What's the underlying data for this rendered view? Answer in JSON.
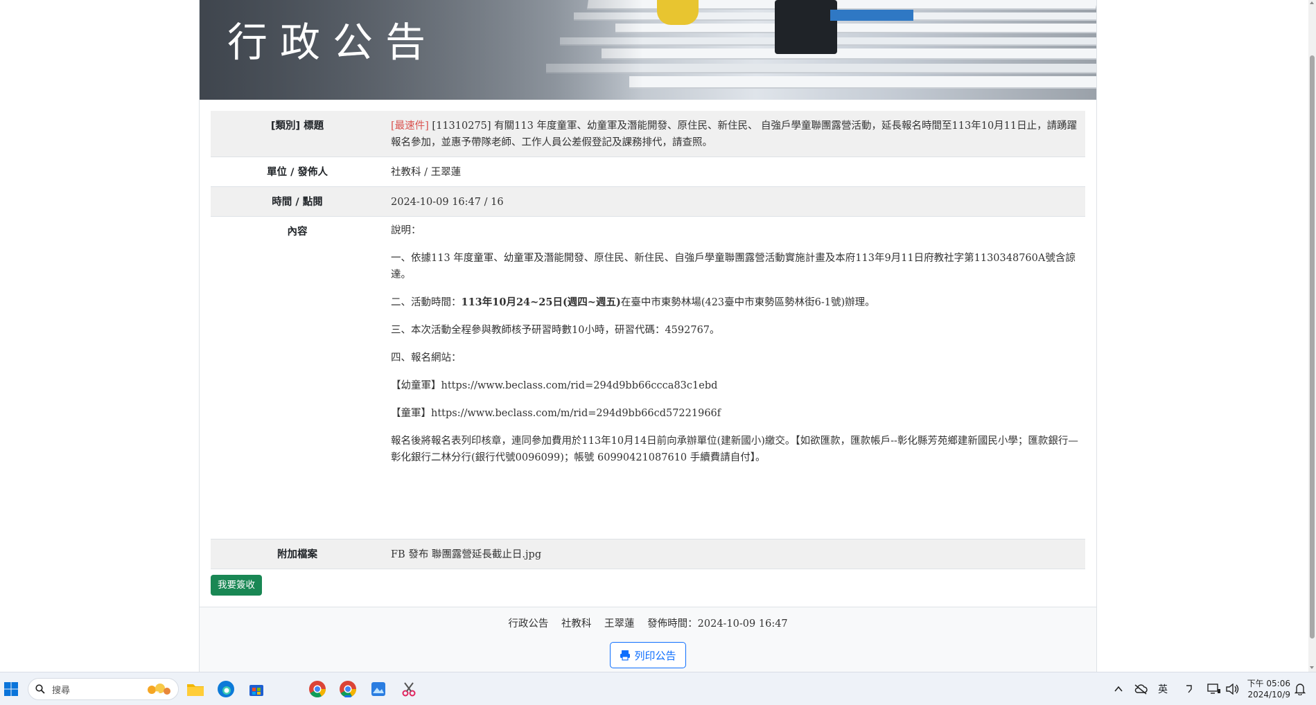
{
  "banner": {
    "title": "行政公告"
  },
  "detail": {
    "title_label": "[類別] 標題",
    "category": "[最速件]",
    "title_text": " [11310275] 有關113 年度童軍、幼童軍及潛能開發、原住民、新住民、 自強戶學童聯團露營活動，延長報名時間至113年10月11日止，請踴躍報名參加，並惠予帶隊老師、工作人員公差假登記及課務排代，請查照。",
    "unit_label": "單位 / 發佈人",
    "unit_value": "社教科 / 王翠蓮",
    "time_label": "時間 / 點閱",
    "time_value": "2024-10-09 16:47 / 16",
    "content_label": "內容",
    "content": {
      "intro": "說明：",
      "p1": "一、依據113 年度童軍、幼童軍及潛能開發、原住民、新住民、自強戶學童聯團露營活動實施計畫及本府113年9月11日府教社字第1130348760A號含諒達。",
      "p2_prefix": "二、活動時間：",
      "p2_bold": "113年10月24~25日(週四~週五)",
      "p2_suffix": "在臺中市東勢林場(423臺中市東勢區勢林街6-1號)辦理。",
      "p3": "三、本次活動全程參與教師核予研習時數10小時，研習代碼：4592767。",
      "p4": "四、報名網站：",
      "p5": "【幼童軍】https://www.beclass.com/rid=294d9bb66ccca83c1ebd",
      "p6": "【童軍】https://www.beclass.com/m/rid=294d9bb66cd57221966f",
      "p7": "報名後將報名表列印核章，連同參加費用於113年10月14日前向承辦單位(建新國小)繳交。【如欲匯款，匯款帳戶--彰化縣芳苑鄉建新國民小學；匯款銀行—彰化銀行二林分行(銀行代號0096099)；帳號 60990421087610 手續費請自付】。"
    },
    "attach_label": "附加檔案",
    "attach_value": "FB 發布 聯團露營延長截止日.jpg"
  },
  "actions": {
    "sign_label": "我要簽收"
  },
  "footer": {
    "category": "行政公告",
    "unit": "社教科",
    "publisher": "王翠蓮",
    "published": "發佈時間：2024-10-09 16:47",
    "print_label": "列印公告"
  },
  "taskbar": {
    "search_placeholder": "搜尋",
    "ime": "英",
    "time": "下午 05:06",
    "date": "2024/10/9"
  },
  "colors": {
    "accent": "#0d6efd",
    "sign": "#198754",
    "urgent": "#d9534f"
  }
}
